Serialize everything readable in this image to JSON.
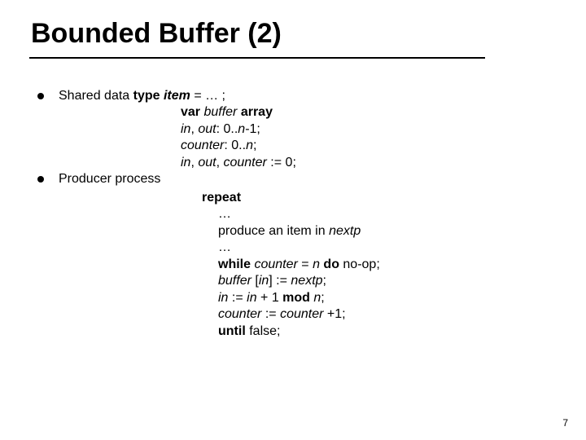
{
  "title": "Bounded Buffer (2)",
  "b1": {
    "l1a": "Shared data ",
    "l1b": "type ",
    "l1c": "item",
    "l1d": " = … ;",
    "l2a": "var ",
    "l2b": "buffer ",
    "l2c": "array",
    "l3a": "in",
    "l3b": ", ",
    "l3c": "out",
    "l3d": ": 0..",
    "l3e": "n",
    "l3f": "-1;",
    "l4a": "counter",
    "l4b": ": 0..",
    "l4c": "n",
    "l4d": ";",
    "l5a": "in",
    "l5b": ", ",
    "l5c": "out",
    "l5d": ", ",
    "l5e": "counter",
    "l5f": " := 0;"
  },
  "b2": {
    "head": "Producer process",
    "c1": "repeat",
    "c2": "…",
    "c3a": "produce an item in ",
    "c3b": "nextp",
    "c4": "…",
    "c5a": "while ",
    "c5b": "counter",
    "c5c": " = ",
    "c5d": "n",
    "c5e": " do ",
    "c5f": "no-op;",
    "c6a": "buffer",
    "c6b": " [",
    "c6c": "in",
    "c6d": "] := ",
    "c6e": "nextp",
    "c6f": ";",
    "c7a": "in",
    "c7b": " := ",
    "c7c": "in",
    "c7d": " + 1 ",
    "c7e": "mod ",
    "c7f": "n",
    "c7g": ";",
    "c8a": "counter",
    "c8b": " := ",
    "c8c": "counter",
    "c8d": " +1;",
    "c9a": "until ",
    "c9b": "false;"
  },
  "pagenum": "7"
}
